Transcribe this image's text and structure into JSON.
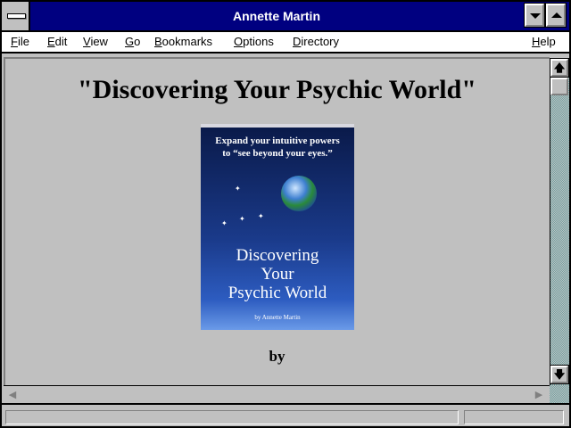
{
  "window": {
    "title": "Annette Martin"
  },
  "menubar": {
    "items": [
      "File",
      "Edit",
      "View",
      "Go",
      "Bookmarks",
      "Options",
      "Directory"
    ],
    "help": "Help"
  },
  "page": {
    "heading": "\"Discovering Your Psychic World\"",
    "book_cover": {
      "tagline_line1": "Expand your intuitive powers",
      "tagline_line2": "to “see beyond your eyes.”",
      "title_line1": "Discovering",
      "title_line2": "Your",
      "title_line3": "Psychic World",
      "author": "by Annette Martin"
    },
    "byline": "by"
  },
  "scrollbars": {
    "up_icon": "arrow-up-icon",
    "down_icon": "arrow-down-icon",
    "left_icon": "arrow-left-icon",
    "right_icon": "arrow-right-icon"
  },
  "statusbar": {
    "status_text": "",
    "progress_text": ""
  },
  "colors": {
    "titlebar": "#000080",
    "window_bg": "#c0c0c0",
    "menubar_bg": "#ffffff",
    "scroll_track": "#6fa3a3"
  }
}
